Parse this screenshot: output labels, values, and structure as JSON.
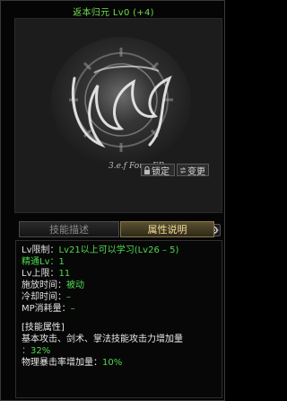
{
  "title": "返本归元 Lv0 (+4)",
  "preview": {
    "lock_label": "锁定",
    "change_label": "变更",
    "signature": "3.e.f ForevER"
  },
  "tabs": [
    {
      "label": "技能描述",
      "active": false
    },
    {
      "label": "属性说明",
      "active": true
    }
  ],
  "info": {
    "lv_limit_label": "Lv限制：",
    "lv_limit_value": "Lv21以上可以学习(Lv26 – 5)",
    "master_lv_label": "精通Lv：",
    "master_lv_value": "1",
    "lv_cap_label": "Lv上限：",
    "lv_cap_value": "11",
    "cast_time_label": "施放时间：",
    "cast_time_value": "被动",
    "cooldown_label": "冷却时间：",
    "cooldown_value": "–",
    "mp_cost_label": "MP消耗量：",
    "mp_cost_value": "–"
  },
  "attributes": {
    "header": "[技能属性]",
    "line1": "基本攻击、剑术、掌法技能攻击力增加量",
    "line1_value": "：32%",
    "line2": "物理暴击率增加量：",
    "line2_value": "10%"
  },
  "colors": {
    "green": "#4fd94f",
    "title_green": "#6fdc4f",
    "gold": "#f1dc9b"
  }
}
